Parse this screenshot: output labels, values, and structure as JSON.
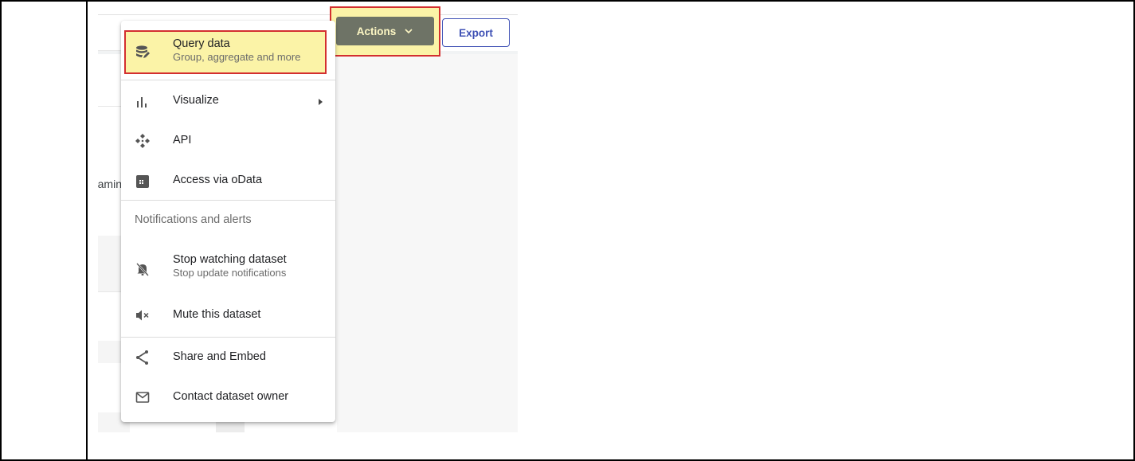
{
  "toolbar": {
    "actions_label": "Actions",
    "export_label": "Export"
  },
  "background": {
    "partial_text": "amin"
  },
  "menu": {
    "items": [
      {
        "label": "Query data",
        "sub": "Group, aggregate and more",
        "icon": "database-query-icon",
        "highlighted": true
      },
      {
        "label": "Visualize",
        "icon": "bar-chart-icon",
        "has_submenu": true
      },
      {
        "label": "API",
        "icon": "api-icon"
      },
      {
        "label": "Access via oData",
        "icon": "odata-grid-icon"
      }
    ],
    "section_title": "Notifications and alerts",
    "notification_items": [
      {
        "label": "Stop watching dataset",
        "sub": "Stop update notifications",
        "icon": "bell-off-icon"
      },
      {
        "label": "Mute this dataset",
        "icon": "volume-mute-icon"
      }
    ],
    "share_items": [
      {
        "label": "Share and Embed",
        "icon": "share-icon"
      },
      {
        "label": "Contact dataset owner",
        "icon": "mail-icon"
      }
    ]
  },
  "colors": {
    "highlight_fill": "#fbf3a7",
    "highlight_border": "#d32f2f",
    "actions_button": "#6e7366",
    "export_accent": "#3f51b5"
  }
}
